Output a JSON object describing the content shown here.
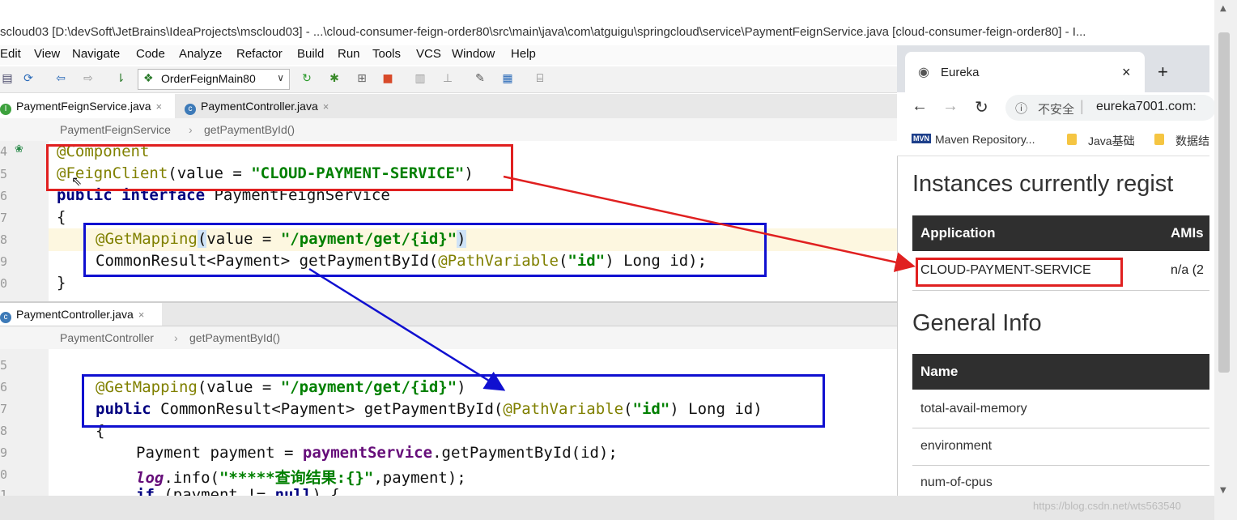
{
  "window": {
    "title": "scloud03 [D:\\devSoft\\JetBrains\\IdeaProjects\\mscloud03] - ...\\cloud-consumer-feign-order80\\src\\main\\java\\com\\atguigu\\springcloud\\service\\PaymentFeignService.java [cloud-consumer-feign-order80] - I..."
  },
  "menu": [
    "Edit",
    "View",
    "Navigate",
    "Code",
    "Analyze",
    "Refactor",
    "Build",
    "Run",
    "Tools",
    "VCS",
    "Window",
    "Help"
  ],
  "toolbar": {
    "run_config": "OrderFeignMain80"
  },
  "editor1": {
    "tabs": [
      {
        "label": "PaymentFeignService.java",
        "close": "×"
      },
      {
        "label": "PaymentController.java",
        "close": "×"
      }
    ],
    "breadcrumb": [
      "PaymentFeignService",
      "getPaymentById()"
    ],
    "line_numbers": [
      "4",
      "5",
      "6",
      "7",
      "8",
      "9",
      "0"
    ]
  },
  "editor2": {
    "tab": {
      "label": "PaymentController.java",
      "close": "×"
    },
    "breadcrumb": [
      "PaymentController",
      "getPaymentById()"
    ],
    "line_numbers": [
      "5",
      "6",
      "7",
      "8",
      "9",
      "0",
      "1"
    ]
  },
  "browser": {
    "tab_title": "Eureka",
    "tab_close": "×",
    "new_tab": "+",
    "insecure_label": "不安全",
    "url": "eureka7001.com:",
    "bookmarks": [
      "Maven Repository...",
      "Java基础",
      "数据结"
    ],
    "bookmark_icon": "MVN",
    "heading_instances": "Instances currently regist",
    "table1": {
      "col_application": "Application",
      "col_amis": "AMIs",
      "app_name": "CLOUD-PAYMENT-SERVICE",
      "amis_value": "n/a (2"
    },
    "heading_general": "General Info",
    "table2": {
      "col_name": "Name",
      "rows": [
        "total-avail-memory",
        "environment",
        "num-of-cpus"
      ]
    }
  },
  "watermark": "https://blog.csdn.net/wts563540",
  "colors": {
    "red_box": "#e02020",
    "blue_box": "#1010d0",
    "annotation": "#808000",
    "keyword": "#000080",
    "string": "#008000"
  }
}
